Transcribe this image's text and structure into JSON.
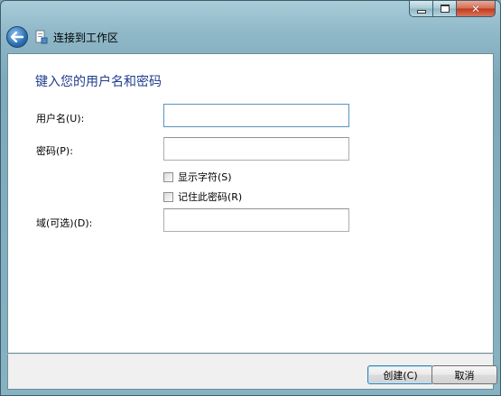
{
  "window": {
    "title": "连接到工作区",
    "controls": {
      "minimize": "minimize",
      "maximize": "maximize",
      "close": "close"
    }
  },
  "nav": {
    "back_icon": "back-arrow-icon",
    "page_icon": "network-workplace-icon"
  },
  "form": {
    "heading": "键入您的用户名和密码",
    "username_label": "用户名(U):",
    "username_value": "",
    "password_label": "密码(P):",
    "password_value": "",
    "show_chars_label": "显示字符(S)",
    "show_chars_checked": false,
    "remember_label": "记住此密码(R)",
    "remember_checked": false,
    "domain_label": "域(可选)(D):",
    "domain_value": ""
  },
  "footer": {
    "create_button": "创建(C)",
    "cancel_button": "取消"
  },
  "colors": {
    "heading": "#1e3d8f",
    "frame": "#86b2c2",
    "close_button": "#c0391b"
  }
}
